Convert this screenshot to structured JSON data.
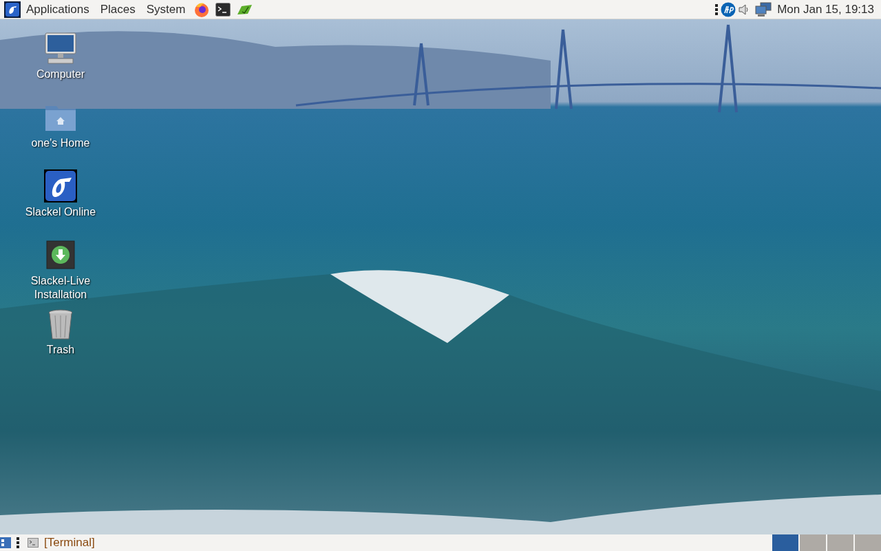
{
  "top_panel": {
    "menus": [
      "Applications",
      "Places",
      "System"
    ],
    "clock": "Mon Jan 15, 19:13"
  },
  "desktop_icons": [
    {
      "label": "Computer",
      "kind": "computer"
    },
    {
      "label": "one's Home",
      "kind": "home"
    },
    {
      "label": "Slackel Online",
      "kind": "slackel"
    },
    {
      "label": "Slackel-Live Installation",
      "kind": "installer"
    },
    {
      "label": "Trash",
      "kind": "trash"
    }
  ],
  "bottom_panel": {
    "tasks": [
      {
        "label": "[Terminal]"
      }
    ],
    "workspaces": [
      {
        "selected": true
      },
      {
        "selected": false
      },
      {
        "selected": false
      },
      {
        "selected": false
      }
    ]
  }
}
